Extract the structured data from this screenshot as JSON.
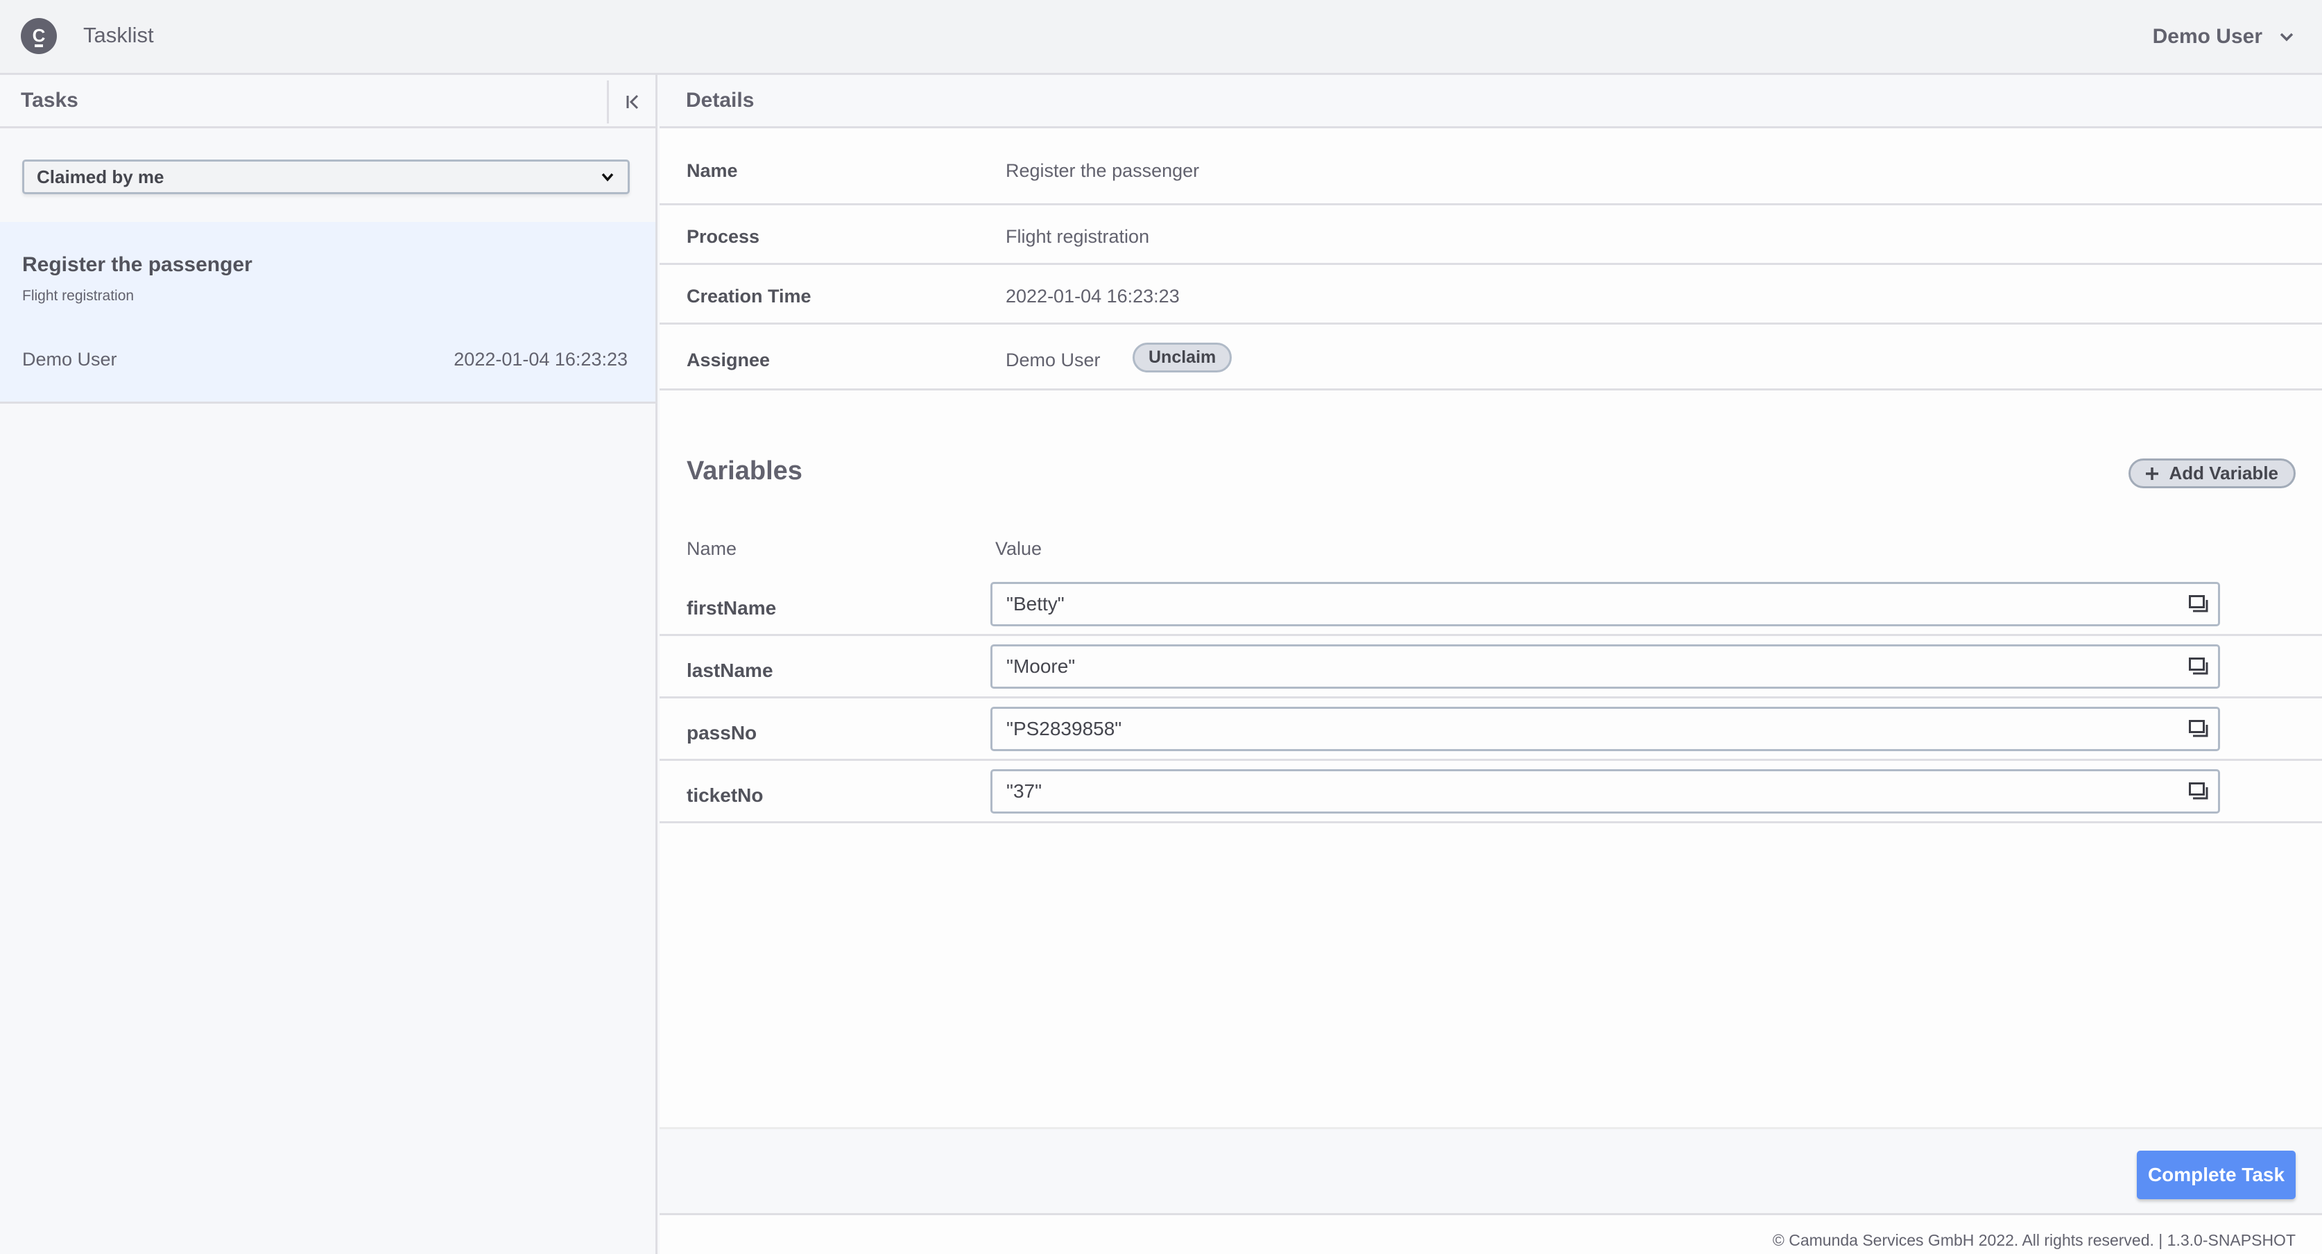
{
  "header": {
    "app_title": "Tasklist",
    "logo_letter": "C",
    "user_name": "Demo User"
  },
  "left_panel": {
    "title": "Tasks",
    "filter": {
      "selected": "Claimed by me"
    },
    "tasks": [
      {
        "name": "Register the passenger",
        "process": "Flight registration",
        "assignee": "Demo User",
        "creation_time": "2022-01-04 16:23:23",
        "selected": true
      }
    ]
  },
  "details": {
    "title": "Details",
    "rows": [
      {
        "label": "Name",
        "value": "Register the passenger"
      },
      {
        "label": "Process",
        "value": "Flight registration"
      },
      {
        "label": "Creation Time",
        "value": "2022-01-04 16:23:23"
      },
      {
        "label": "Assignee",
        "value": "Demo User"
      }
    ],
    "unclaim_label": "Unclaim"
  },
  "variables": {
    "title": "Variables",
    "add_label": "Add Variable",
    "columns": {
      "name": "Name",
      "value": "Value"
    },
    "items": [
      {
        "name": "firstName",
        "value": "\"Betty\""
      },
      {
        "name": "lastName",
        "value": "\"Moore\""
      },
      {
        "name": "passNo",
        "value": "\"PS2839858\""
      },
      {
        "name": "ticketNo",
        "value": "\"37\""
      }
    ]
  },
  "actions": {
    "complete_label": "Complete Task",
    "primary_color": "#5b8ff5"
  },
  "footer": {
    "text": "© Camunda Services GmbH 2022. All rights reserved. | 1.3.0-SNAPSHOT"
  }
}
